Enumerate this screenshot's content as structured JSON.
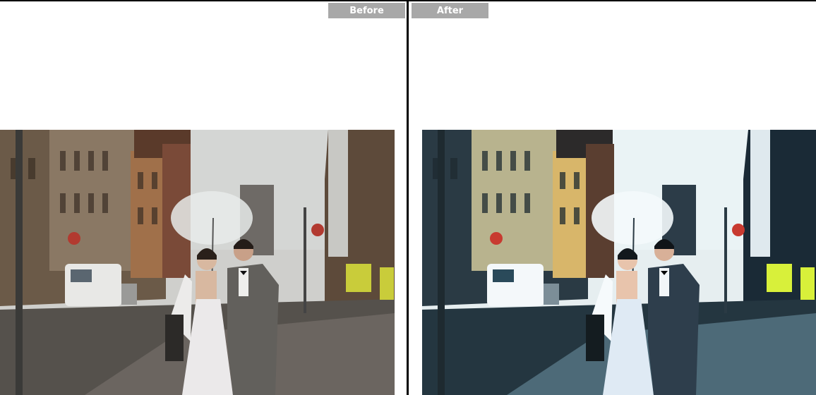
{
  "labels": {
    "before": "Before",
    "after": "After"
  },
  "photos": {
    "before": {
      "subject": "wedding-couple-umbrella-street"
    },
    "after": {
      "subject": "wedding-couple-umbrella-street"
    }
  },
  "colors": {
    "label_bg": "#a8a8a8",
    "label_text": "#ffffff",
    "divider": "#000000"
  }
}
